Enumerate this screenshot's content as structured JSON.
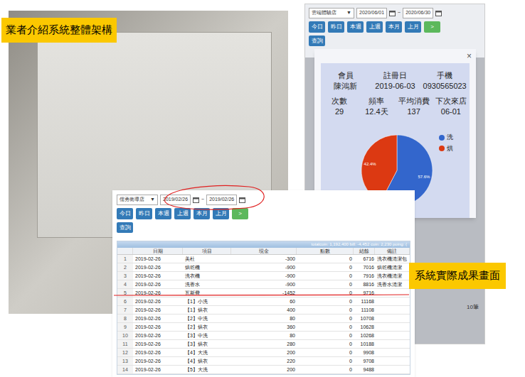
{
  "labels": {
    "architecture": "業者介紹系統整體架構",
    "results": "系統實際成果畫面"
  },
  "member_screen": {
    "store": "雲端體驗店",
    "dropdown_arrow": "▼",
    "date_from": "2020/06/01",
    "separator": "~",
    "date_to": "2020/06/30",
    "buttons": [
      {
        "label": "今日",
        "color": "#337ab7"
      },
      {
        "label": "昨日",
        "color": "#337ab7"
      },
      {
        "label": "本週",
        "color": "#337ab7"
      },
      {
        "label": "上週",
        "color": "#337ab7"
      },
      {
        "label": "本月",
        "color": "#337ab7"
      },
      {
        "label": "上月",
        "color": "#337ab7"
      },
      {
        "label": ">",
        "color": "#5cb85c"
      }
    ],
    "query": "查詢",
    "dialog": {
      "close": "×",
      "member": [
        {
          "label": "會員",
          "value": "陳鴻新"
        },
        {
          "label": "註冊日",
          "value": "2019-06-03"
        },
        {
          "label": "手機",
          "value": "0930565023"
        }
      ],
      "stats": [
        {
          "label": "次數",
          "value": "29"
        },
        {
          "label": "頻率",
          "value": "12.4天"
        },
        {
          "label": "平均消費",
          "value": "137"
        },
        {
          "label": "下次來店",
          "value": "06-01"
        }
      ],
      "chart": {
        "series": [
          {
            "name": "洗",
            "values": [
              57.6
            ],
            "reading": "57.6%",
            "color": "#3366cc"
          },
          {
            "name": "烘",
            "values": [
              42.4
            ],
            "reading": "42.4%",
            "color": "#dc3912"
          }
        ]
      }
    },
    "footer": "10筆"
  },
  "ledger_screen": {
    "store": "儒勇衛導店",
    "dropdown_arrow": "▼",
    "date_from": "2019/02/26",
    "separator": "~",
    "date_to": "2019/02/26",
    "buttons": [
      {
        "label": "今日",
        "color": "#337ab7"
      },
      {
        "label": "昨日",
        "color": "#337ab7"
      },
      {
        "label": "本週",
        "color": "#337ab7"
      },
      {
        "label": "上週",
        "color": "#337ab7"
      },
      {
        "label": "本月",
        "color": "#337ab7"
      },
      {
        "label": "上月",
        "color": "#337ab7"
      },
      {
        "label": ">",
        "color": "#5cb85c"
      }
    ],
    "query": "查詢",
    "summary": "totalcoin: 1,192,400 bill: -4,452 coin: 2,230 poing: (",
    "columns": [
      "",
      "日期",
      "項目",
      "現金",
      "點數",
      "結餘",
      "備註"
    ],
    "rows": [
      [
        "1",
        "2019-02-26",
        "美杜",
        "-300",
        "0",
        "6716",
        "洗衣機清潔包"
      ],
      [
        "2",
        "2019-02-26",
        "烘乾機",
        "-900",
        "0",
        "7016",
        "烘乾機清潔"
      ],
      [
        "3",
        "2019-02-26",
        "洗衣機",
        "-900",
        "0",
        "7916",
        "洗衣機清潔"
      ],
      [
        "4",
        "2019-02-26",
        "洗香水",
        "-900",
        "0",
        "8816",
        "洗香水清潔"
      ],
      [
        "5",
        "2019-02-26",
        "瓦斯費",
        "-1452",
        "0",
        "9716",
        ""
      ],
      [
        "6",
        "2019-02-26",
        "【1】小洗",
        "60",
        "0",
        "11168",
        ""
      ],
      [
        "7",
        "2019-02-26",
        "【1】烘衣",
        "400",
        "0",
        "11108",
        ""
      ],
      [
        "8",
        "2019-02-26",
        "【2】中洗",
        "80",
        "0",
        "10708",
        ""
      ],
      [
        "9",
        "2019-02-26",
        "【2】烘衣",
        "360",
        "0",
        "10628",
        ""
      ],
      [
        "10",
        "2019-02-26",
        "【3】中洗",
        "80",
        "0",
        "10268",
        ""
      ],
      [
        "11",
        "2019-02-26",
        "【3】烘衣",
        "280",
        "0",
        "10188",
        ""
      ],
      [
        "12",
        "2019-02-26",
        "【4】大洗",
        "200",
        "0",
        "9908",
        ""
      ],
      [
        "13",
        "2019-02-26",
        "【4】烘衣",
        "220",
        "0",
        "9708",
        ""
      ],
      [
        "14",
        "2019-02-26",
        "【5】大洗",
        "200",
        "0",
        "9488",
        ""
      ]
    ]
  }
}
